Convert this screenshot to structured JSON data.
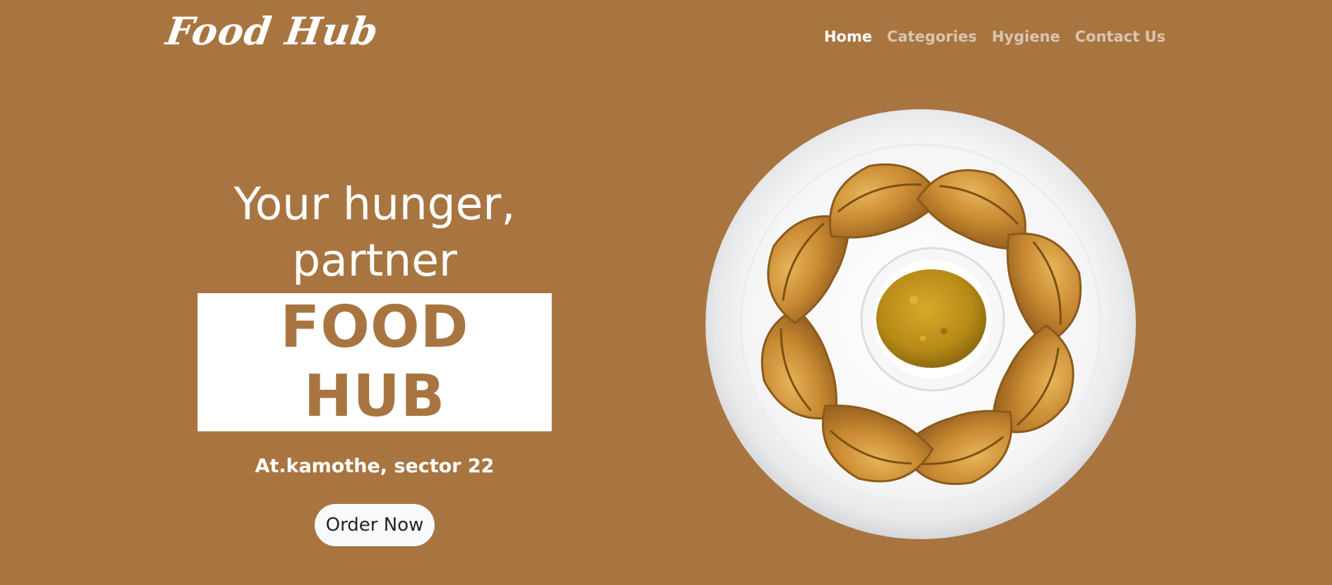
{
  "brand": {
    "logo_text": "Food Hub"
  },
  "nav": {
    "items": [
      {
        "label": "Home",
        "active": true
      },
      {
        "label": "Categories",
        "active": false
      },
      {
        "label": "Hygiene",
        "active": false
      },
      {
        "label": "Contact Us",
        "active": false
      }
    ]
  },
  "hero": {
    "headline_line1": "Your hunger,",
    "headline_line2": "partner",
    "highlight": "FOOD HUB",
    "location": "At.kamothe, sector 22",
    "cta_label": "Order Now",
    "image_description_icon": "momos-plate-image"
  },
  "colors": {
    "background": "#a87541",
    "text": "#ffffff",
    "button_bg": "#f8f9fa",
    "button_text": "#212529",
    "nav_inactive": "rgba(255,255,255,0.58)"
  }
}
